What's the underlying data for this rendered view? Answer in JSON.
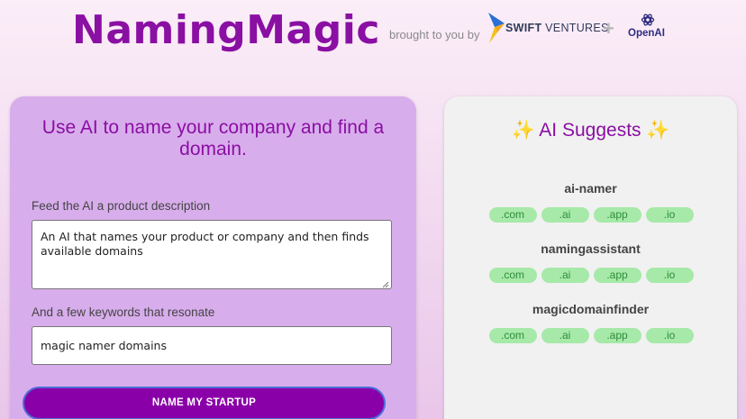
{
  "header": {
    "title": "NamingMagic",
    "brought_by": "brought to you by",
    "swift_bold": "SWIFT",
    "swift_rest": "VENTURES",
    "plus": "+",
    "openai": "OpenAI"
  },
  "form": {
    "heading": "Use AI to name your company and find a domain.",
    "description_label": "Feed the AI a product description",
    "description_value": "An AI that names your product or company and then finds available domains",
    "keywords_label": "And a few keywords that resonate",
    "keywords_value": "magic namer domains",
    "submit_label": "NAME MY STARTUP"
  },
  "suggestions": {
    "sparkle": "✨",
    "heading": "AI Suggests",
    "items": [
      {
        "name": "ai-namer",
        "tlds": [
          ".com",
          ".ai",
          ".app",
          ".io"
        ]
      },
      {
        "name": "namingassistant",
        "tlds": [
          ".com",
          ".ai",
          ".app",
          ".io"
        ]
      },
      {
        "name": "magicdomainfinder",
        "tlds": [
          ".com",
          ".ai",
          ".app",
          ".io"
        ]
      }
    ]
  },
  "colors": {
    "brand": "#8a0fa3",
    "button": "#8a00a8",
    "pill_bg": "#a6e9a8",
    "pill_text": "#2f8c3a"
  }
}
